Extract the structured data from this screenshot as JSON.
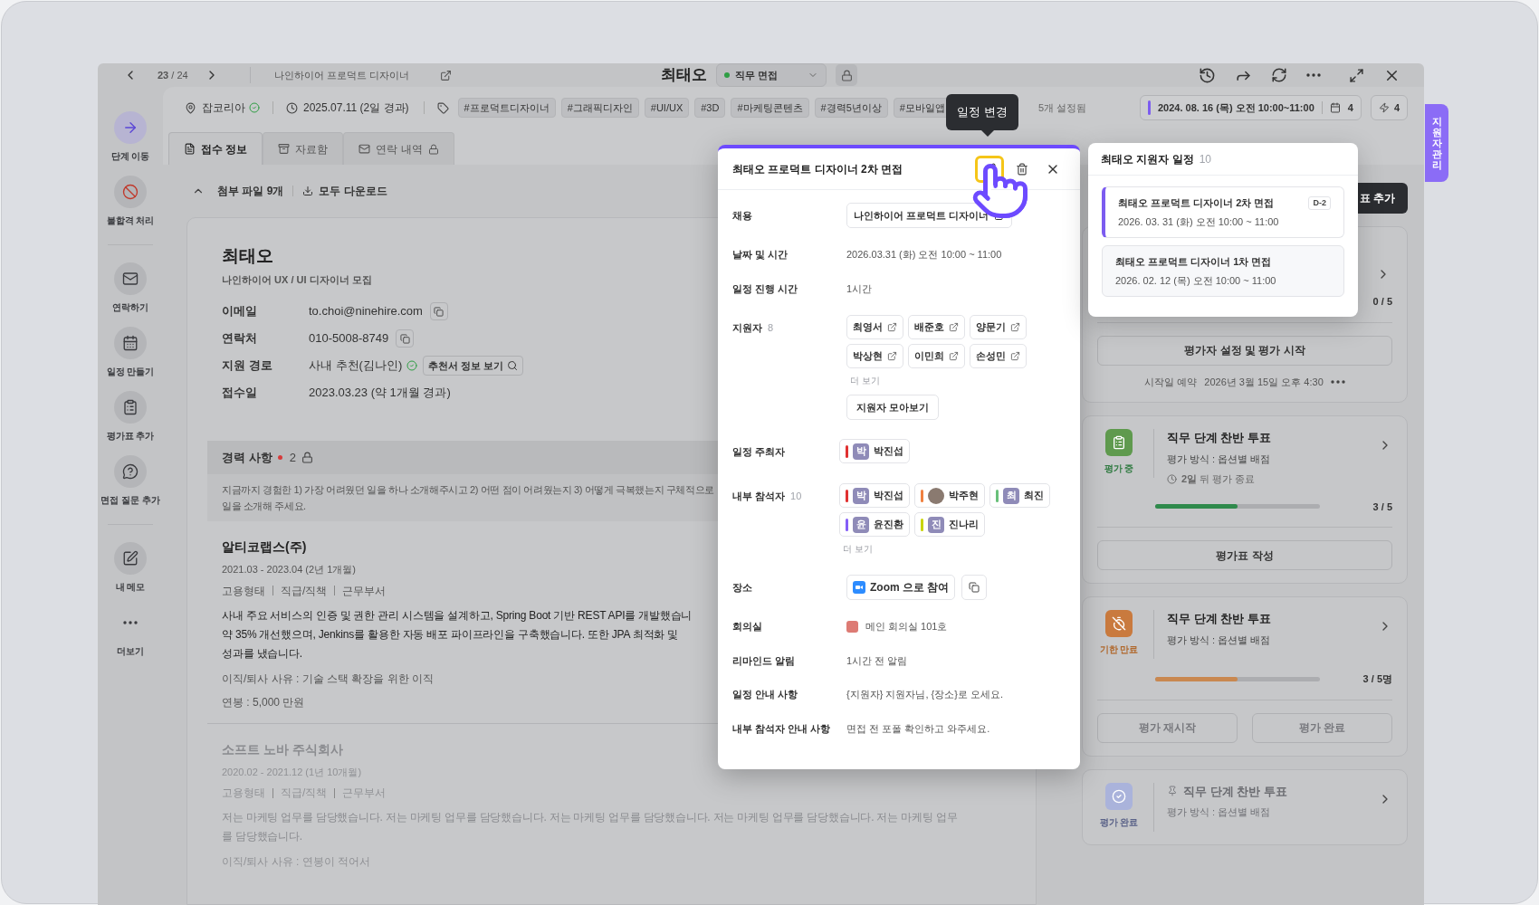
{
  "nav": {
    "pager": "**23** / 24",
    "job": "나인하이어 프로덕트 디자이너"
  },
  "title": {
    "name": "최태오",
    "stage": "직무 면접"
  },
  "sidebar": {
    "groups": [
      {
        "items": [
          {
            "label": "단계 이동",
            "kind": "move"
          },
          {
            "label": "불합격 처리",
            "kind": "reject"
          }
        ]
      },
      {
        "items": [
          {
            "label": "연락하기",
            "kind": "contact"
          },
          {
            "label": "일정 만들기",
            "kind": "schedule"
          },
          {
            "label": "평가표 추가",
            "kind": "evaluation"
          },
          {
            "label": "면접 질문 추가",
            "kind": "question"
          }
        ]
      },
      {
        "items": [
          {
            "label": "내 메모",
            "kind": "memo"
          },
          {
            "label": "더보기",
            "kind": "more"
          }
        ]
      }
    ]
  },
  "info": {
    "source": "잡코리아",
    "source_verified": true,
    "date": "2025.07.11 (2일 경과)",
    "tags": [
      "#프로덕트디자이너",
      "#그래픽디자인",
      "#UI/UX",
      "#3D",
      "#마케팅콘텐츠",
      "#경력5년이상",
      "#모바일앱"
    ],
    "tags_more": "5개 설정됨",
    "schedule": "2024. 08. 16 (목) 오전 10:00~11:00",
    "schedule_count": "4",
    "action_count": "4"
  },
  "tabs": [
    {
      "label": "접수 정보",
      "selected": true,
      "kind": "info",
      "locked": false
    },
    {
      "label": "자료함",
      "selected": false,
      "kind": "files",
      "locked": false
    },
    {
      "label": "연락 내역",
      "selected": false,
      "kind": "contact",
      "locked": true
    }
  ],
  "attachments": {
    "label": "첨부 파일 9개",
    "expanded": true,
    "download": "모두 다운로드"
  },
  "profile": {
    "name": "최태오",
    "subtitle": "나인하이어 UX / UI 디자이너 모집",
    "fields": [
      {
        "label": "이메일",
        "value": "to.choi@ninehire.com",
        "kind": "copy"
      },
      {
        "label": "연락처",
        "value": "010-5008-8749",
        "kind": "copy"
      },
      {
        "label": "지원 경로",
        "value": "사내 추천(김나인)",
        "kind": "referral",
        "verified": true,
        "action": "추천서 정보 보기"
      },
      {
        "label": "접수일",
        "value": "2023.03.23 (약 1개월 경과)",
        "kind": "plain"
      }
    ]
  },
  "career": {
    "title": "경력 사항",
    "required": true,
    "count": "2",
    "locked": true,
    "prompt": [
      "지금까지 경험한 1) 가장 어려웠던 일을 하나 소개해주시고 2) 어떤 점이 어려웠는지 3) 어떻게 극복했는지 구체적으로",
      "일을 소개해 주세요."
    ],
    "entries": [
      {
        "company": "알티코랩스(주)",
        "period": "2021.03 - 2023.04 (2년 1개월)",
        "meta": [
          "고용형태",
          "직급/직책",
          "근무부서"
        ],
        "description": [
          "사내 주요 서비스의 인증 및 권한 관리 시스템을 설계하고, Spring Boot 기반 REST API를 개발했습니",
          "약 35% 개선했으며, Jenkins를 활용한 자동 배포 파이프라인을 구축했습니다. 또한 JPA 최적화 및",
          "성과를 냈습니다."
        ],
        "reason": "이직/퇴사 사유 : 기술 스택 확장을 위한 이직",
        "salary": "연봉 : 5,000 만원",
        "faded": false
      },
      {
        "company": "소프트 노바 주식회사",
        "period": "2020.02 - 2021.12 (1년 10개월)",
        "meta": [
          "고용형태",
          "직급/직책",
          "근무부서"
        ],
        "description": [
          "저는 마케팅 업무를 담당했습니다. 저는 마케팅 업무를 담당했습니다. 저는 마케팅 업무를 담당했습니다. 저는 마케팅 업무를 담당했습니다. 저는 마케팅 업무를 담당했습니다."
        ],
        "reason": "이직/퇴사 사유 : 연봉이 적어서",
        "faded": true
      }
    ]
  },
  "right_panel": {
    "add_button": "표 추가",
    "cards": [
      {
        "kind": "pending",
        "level": 0,
        "count": "0 / 5",
        "actions": [
          "평가자 설정 및 평가 시작"
        ],
        "scheduled_label": "시작일 예약",
        "scheduled_value": "2026년 3월 15일 오후 4:30"
      },
      {
        "kind": "active",
        "status": "평가 중",
        "title": "직무 단계 찬반 투표",
        "method": "평가 방식 : 옵션별 배점",
        "deadline": "**2일** 뒤 평가 종료",
        "level": 0.5,
        "count": "3 / 5",
        "actions": [
          "평가표 작성"
        ]
      },
      {
        "kind": "expired",
        "status": "기한 만료",
        "title": "직무 단계 찬반 투표",
        "method": "평가 방식 : 옵션별 배점",
        "level": 0.5,
        "count": "3 / 5명",
        "actions": [
          "평가 재시작",
          "평가 완료"
        ]
      },
      {
        "kind": "done",
        "status": "평가 완료",
        "title": "직무 단계 찬반 투표",
        "method": "평가 방식 : 옵션별 배점",
        "pinned": true
      }
    ]
  },
  "tooltip": "일정 변경",
  "side_tab": "지원자 관리",
  "schedule_popup": {
    "title": "최태오 프로덕트 디자이너 2차 면접",
    "edit_highlighted": true,
    "rows": [
      {
        "kind": "link",
        "label": "채용",
        "value": "나인하이어 프로덕트 디자이너"
      },
      {
        "kind": "text",
        "label": "날짜 및 시간",
        "value": "2026.03.31 (화) 오전 10:00 ~ 11:00"
      },
      {
        "kind": "text",
        "label": "일정 진행 시간",
        "value": "1시간"
      },
      {
        "kind": "applicants",
        "label": "지원자",
        "count": "8",
        "people": [
          "최영서",
          "배준호",
          "양문기",
          "박상현",
          "이민희",
          "손성민"
        ],
        "more": "더 보기",
        "action": "지원자 모아보기"
      },
      {
        "kind": "members",
        "label": "일정 주최자",
        "people": [
          {
            "name": "박진섭",
            "initial": "박",
            "color": "#e03131",
            "kind": "initial"
          }
        ]
      },
      {
        "kind": "members",
        "label": "내부 참석자",
        "count": "10",
        "people": [
          {
            "name": "박진섭",
            "initial": "박",
            "color": "#e03131",
            "kind": "initial"
          },
          {
            "name": "박주현",
            "color": "#f08040",
            "kind": "photo"
          },
          {
            "name": "최진",
            "initial": "최",
            "color": "#69c07a",
            "kind": "initial"
          },
          {
            "name": "윤진환",
            "initial": "윤",
            "color": "#845ef7",
            "kind": "initial"
          },
          {
            "name": "진나리",
            "initial": "진",
            "color": "#c8d400",
            "kind": "initial"
          }
        ],
        "more": "더 보기"
      },
      {
        "kind": "place",
        "label": "장소",
        "value": "Zoom 으로 참여"
      },
      {
        "kind": "room",
        "label": "회의실",
        "value": "메인 회의실 101호",
        "color": "#dd7b74"
      },
      {
        "kind": "text",
        "label": "리마인드 알림",
        "value": "1시간 전 알림"
      },
      {
        "kind": "text",
        "label": "일정 안내 사항",
        "value": "{지원자} 지원자님, {장소}로 오세요."
      },
      {
        "kind": "text",
        "label": "내부 참석자 안내 사항",
        "value": "면접 전 포폴 확인하고 와주세요."
      }
    ]
  },
  "applicant_schedule": {
    "title": "최태오 지원자 일정",
    "count": "10",
    "items": [
      {
        "title": "최태오 프로덕트 디자이너 2차 면접",
        "time": "2026. 03. 31 (화) 오전 10:00 ~ 11:00",
        "badge": "D-2",
        "selected": true
      },
      {
        "title": "최태오 프로덕트 디자이너 1차 면접",
        "time": "2026. 02. 12 (목) 오전 10:00 ~ 11:00",
        "selected": false
      }
    ]
  }
}
